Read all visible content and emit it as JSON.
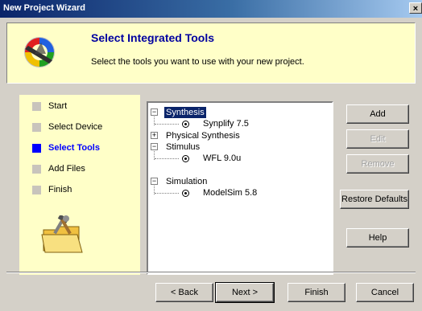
{
  "window": {
    "title": "New Project Wizard",
    "close_glyph": "×"
  },
  "header": {
    "title": "Select Integrated Tools",
    "subtitle": "Select the tools you want to use with your new project.",
    "logo_icon": "wizard-logo-icon"
  },
  "steps": [
    {
      "label": "Start",
      "active": false
    },
    {
      "label": "Select Device",
      "active": false
    },
    {
      "label": "Select Tools",
      "active": true
    },
    {
      "label": "Add Files",
      "active": false
    },
    {
      "label": "Finish",
      "active": false
    }
  ],
  "tree": {
    "items": [
      {
        "label": "Synthesis",
        "expanded": true,
        "selected": true,
        "children": [
          {
            "label": "Synplify 7.5"
          }
        ]
      },
      {
        "label": "Physical Synthesis",
        "expanded": false,
        "selected": false,
        "children": []
      },
      {
        "label": "Stimulus",
        "expanded": true,
        "selected": false,
        "children": [
          {
            "label": "WFL 9.0u"
          }
        ]
      },
      {
        "label": "Simulation",
        "expanded": true,
        "selected": false,
        "children": [
          {
            "label": "ModelSim 5.8"
          }
        ]
      }
    ]
  },
  "side_buttons": {
    "add": "Add",
    "edit": "Edit",
    "remove": "Remove",
    "restore": "Restore Defaults",
    "help": "Help"
  },
  "footer_buttons": {
    "back": "< Back",
    "next": "Next >",
    "finish": "Finish",
    "cancel": "Cancel"
  },
  "colors": {
    "header_bg": "#ffffc8",
    "title_blue": "#0000a0",
    "active_step": "#0000ff",
    "selection": "#0a246a"
  }
}
